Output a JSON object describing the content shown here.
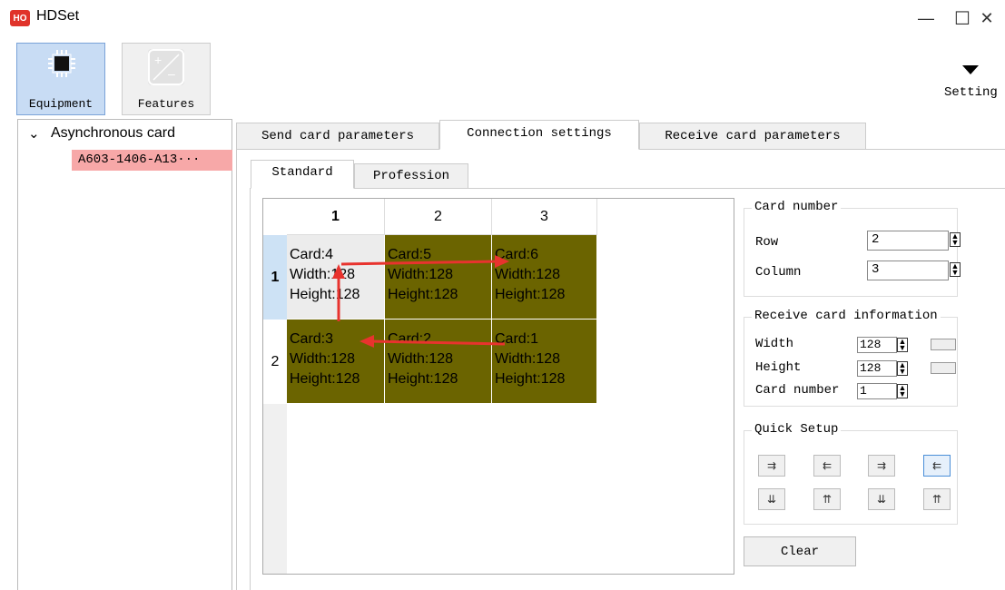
{
  "window": {
    "logo_text": "HO",
    "title": "HDSet",
    "minimize": "—",
    "maximize": "☐",
    "close": "✕"
  },
  "toolbar": {
    "equipment_label": "Equipment",
    "features_label": "Features",
    "setting_label": "Setting"
  },
  "tree": {
    "root_label": "Asynchronous card",
    "leaf_label": "A603-1406-A13···"
  },
  "tabs": [
    "Send card parameters",
    "Connection settings",
    "Receive card parameters"
  ],
  "subtabs": [
    "Standard",
    "Profession"
  ],
  "grid": {
    "columns": [
      "1",
      "2",
      "3"
    ],
    "rows": [
      "1",
      "2"
    ],
    "cells": [
      [
        {
          "card": "Card:4",
          "width": "Width:128",
          "height": "Height:128"
        },
        {
          "card": "Card:5",
          "width": "Width:128",
          "height": "Height:128"
        },
        {
          "card": "Card:6",
          "width": "Width:128",
          "height": "Height:128"
        }
      ],
      [
        {
          "card": "Card:3",
          "width": "Width:128",
          "height": "Height:128"
        },
        {
          "card": "Card:2",
          "width": "Width:128",
          "height": "Height:128"
        },
        {
          "card": "Card:1",
          "width": "Width:128",
          "height": "Height:128"
        }
      ]
    ],
    "cell_color": "#6b6400",
    "arrow_color": "#e8332e"
  },
  "card_number": {
    "title": "Card number",
    "row_label": "Row",
    "row_value": "2",
    "column_label": "Column",
    "column_value": "3"
  },
  "receive_info": {
    "title": "Receive card information",
    "width_label": "Width",
    "width_value": "128",
    "height_label": "Height",
    "height_value": "128",
    "card_number_label": "Card number",
    "card_number_value": "1"
  },
  "quick_setup": {
    "title": "Quick Setup",
    "buttons": [
      "⇉",
      "⇇",
      "⇉",
      "⇇",
      "⇊",
      "⇈",
      "⇊",
      "⇈"
    ]
  },
  "clear_label": "Clear"
}
